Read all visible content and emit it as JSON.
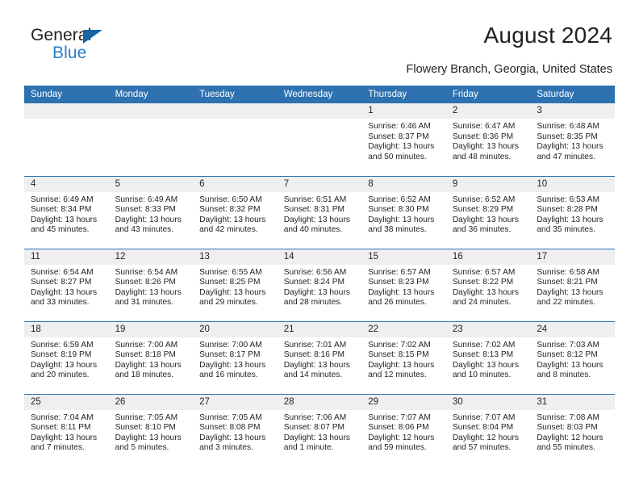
{
  "brand": {
    "name_part1": "General",
    "name_part2": "Blue",
    "logo_icon": "triangle-logo"
  },
  "header": {
    "title": "August 2024",
    "location": "Flowery Branch, Georgia, United States"
  },
  "calendar": {
    "weekday_headers": [
      "Sunday",
      "Monday",
      "Tuesday",
      "Wednesday",
      "Thursday",
      "Friday",
      "Saturday"
    ],
    "accent_color": "#2e71b0",
    "daynum_band_color": "#efefef",
    "weeks": [
      [
        {
          "day": ""
        },
        {
          "day": ""
        },
        {
          "day": ""
        },
        {
          "day": ""
        },
        {
          "day": "1",
          "sunrise": "Sunrise: 6:46 AM",
          "sunset": "Sunset: 8:37 PM",
          "daylight_line1": "Daylight: 13 hours",
          "daylight_line2": "and 50 minutes."
        },
        {
          "day": "2",
          "sunrise": "Sunrise: 6:47 AM",
          "sunset": "Sunset: 8:36 PM",
          "daylight_line1": "Daylight: 13 hours",
          "daylight_line2": "and 48 minutes."
        },
        {
          "day": "3",
          "sunrise": "Sunrise: 6:48 AM",
          "sunset": "Sunset: 8:35 PM",
          "daylight_line1": "Daylight: 13 hours",
          "daylight_line2": "and 47 minutes."
        }
      ],
      [
        {
          "day": "4",
          "sunrise": "Sunrise: 6:49 AM",
          "sunset": "Sunset: 8:34 PM",
          "daylight_line1": "Daylight: 13 hours",
          "daylight_line2": "and 45 minutes."
        },
        {
          "day": "5",
          "sunrise": "Sunrise: 6:49 AM",
          "sunset": "Sunset: 8:33 PM",
          "daylight_line1": "Daylight: 13 hours",
          "daylight_line2": "and 43 minutes."
        },
        {
          "day": "6",
          "sunrise": "Sunrise: 6:50 AM",
          "sunset": "Sunset: 8:32 PM",
          "daylight_line1": "Daylight: 13 hours",
          "daylight_line2": "and 42 minutes."
        },
        {
          "day": "7",
          "sunrise": "Sunrise: 6:51 AM",
          "sunset": "Sunset: 8:31 PM",
          "daylight_line1": "Daylight: 13 hours",
          "daylight_line2": "and 40 minutes."
        },
        {
          "day": "8",
          "sunrise": "Sunrise: 6:52 AM",
          "sunset": "Sunset: 8:30 PM",
          "daylight_line1": "Daylight: 13 hours",
          "daylight_line2": "and 38 minutes."
        },
        {
          "day": "9",
          "sunrise": "Sunrise: 6:52 AM",
          "sunset": "Sunset: 8:29 PM",
          "daylight_line1": "Daylight: 13 hours",
          "daylight_line2": "and 36 minutes."
        },
        {
          "day": "10",
          "sunrise": "Sunrise: 6:53 AM",
          "sunset": "Sunset: 8:28 PM",
          "daylight_line1": "Daylight: 13 hours",
          "daylight_line2": "and 35 minutes."
        }
      ],
      [
        {
          "day": "11",
          "sunrise": "Sunrise: 6:54 AM",
          "sunset": "Sunset: 8:27 PM",
          "daylight_line1": "Daylight: 13 hours",
          "daylight_line2": "and 33 minutes."
        },
        {
          "day": "12",
          "sunrise": "Sunrise: 6:54 AM",
          "sunset": "Sunset: 8:26 PM",
          "daylight_line1": "Daylight: 13 hours",
          "daylight_line2": "and 31 minutes."
        },
        {
          "day": "13",
          "sunrise": "Sunrise: 6:55 AM",
          "sunset": "Sunset: 8:25 PM",
          "daylight_line1": "Daylight: 13 hours",
          "daylight_line2": "and 29 minutes."
        },
        {
          "day": "14",
          "sunrise": "Sunrise: 6:56 AM",
          "sunset": "Sunset: 8:24 PM",
          "daylight_line1": "Daylight: 13 hours",
          "daylight_line2": "and 28 minutes."
        },
        {
          "day": "15",
          "sunrise": "Sunrise: 6:57 AM",
          "sunset": "Sunset: 8:23 PM",
          "daylight_line1": "Daylight: 13 hours",
          "daylight_line2": "and 26 minutes."
        },
        {
          "day": "16",
          "sunrise": "Sunrise: 6:57 AM",
          "sunset": "Sunset: 8:22 PM",
          "daylight_line1": "Daylight: 13 hours",
          "daylight_line2": "and 24 minutes."
        },
        {
          "day": "17",
          "sunrise": "Sunrise: 6:58 AM",
          "sunset": "Sunset: 8:21 PM",
          "daylight_line1": "Daylight: 13 hours",
          "daylight_line2": "and 22 minutes."
        }
      ],
      [
        {
          "day": "18",
          "sunrise": "Sunrise: 6:59 AM",
          "sunset": "Sunset: 8:19 PM",
          "daylight_line1": "Daylight: 13 hours",
          "daylight_line2": "and 20 minutes."
        },
        {
          "day": "19",
          "sunrise": "Sunrise: 7:00 AM",
          "sunset": "Sunset: 8:18 PM",
          "daylight_line1": "Daylight: 13 hours",
          "daylight_line2": "and 18 minutes."
        },
        {
          "day": "20",
          "sunrise": "Sunrise: 7:00 AM",
          "sunset": "Sunset: 8:17 PM",
          "daylight_line1": "Daylight: 13 hours",
          "daylight_line2": "and 16 minutes."
        },
        {
          "day": "21",
          "sunrise": "Sunrise: 7:01 AM",
          "sunset": "Sunset: 8:16 PM",
          "daylight_line1": "Daylight: 13 hours",
          "daylight_line2": "and 14 minutes."
        },
        {
          "day": "22",
          "sunrise": "Sunrise: 7:02 AM",
          "sunset": "Sunset: 8:15 PM",
          "daylight_line1": "Daylight: 13 hours",
          "daylight_line2": "and 12 minutes."
        },
        {
          "day": "23",
          "sunrise": "Sunrise: 7:02 AM",
          "sunset": "Sunset: 8:13 PM",
          "daylight_line1": "Daylight: 13 hours",
          "daylight_line2": "and 10 minutes."
        },
        {
          "day": "24",
          "sunrise": "Sunrise: 7:03 AM",
          "sunset": "Sunset: 8:12 PM",
          "daylight_line1": "Daylight: 13 hours",
          "daylight_line2": "and 8 minutes."
        }
      ],
      [
        {
          "day": "25",
          "sunrise": "Sunrise: 7:04 AM",
          "sunset": "Sunset: 8:11 PM",
          "daylight_line1": "Daylight: 13 hours",
          "daylight_line2": "and 7 minutes."
        },
        {
          "day": "26",
          "sunrise": "Sunrise: 7:05 AM",
          "sunset": "Sunset: 8:10 PM",
          "daylight_line1": "Daylight: 13 hours",
          "daylight_line2": "and 5 minutes."
        },
        {
          "day": "27",
          "sunrise": "Sunrise: 7:05 AM",
          "sunset": "Sunset: 8:08 PM",
          "daylight_line1": "Daylight: 13 hours",
          "daylight_line2": "and 3 minutes."
        },
        {
          "day": "28",
          "sunrise": "Sunrise: 7:06 AM",
          "sunset": "Sunset: 8:07 PM",
          "daylight_line1": "Daylight: 13 hours",
          "daylight_line2": "and 1 minute."
        },
        {
          "day": "29",
          "sunrise": "Sunrise: 7:07 AM",
          "sunset": "Sunset: 8:06 PM",
          "daylight_line1": "Daylight: 12 hours",
          "daylight_line2": "and 59 minutes."
        },
        {
          "day": "30",
          "sunrise": "Sunrise: 7:07 AM",
          "sunset": "Sunset: 8:04 PM",
          "daylight_line1": "Daylight: 12 hours",
          "daylight_line2": "and 57 minutes."
        },
        {
          "day": "31",
          "sunrise": "Sunrise: 7:08 AM",
          "sunset": "Sunset: 8:03 PM",
          "daylight_line1": "Daylight: 12 hours",
          "daylight_line2": "and 55 minutes."
        }
      ]
    ]
  }
}
